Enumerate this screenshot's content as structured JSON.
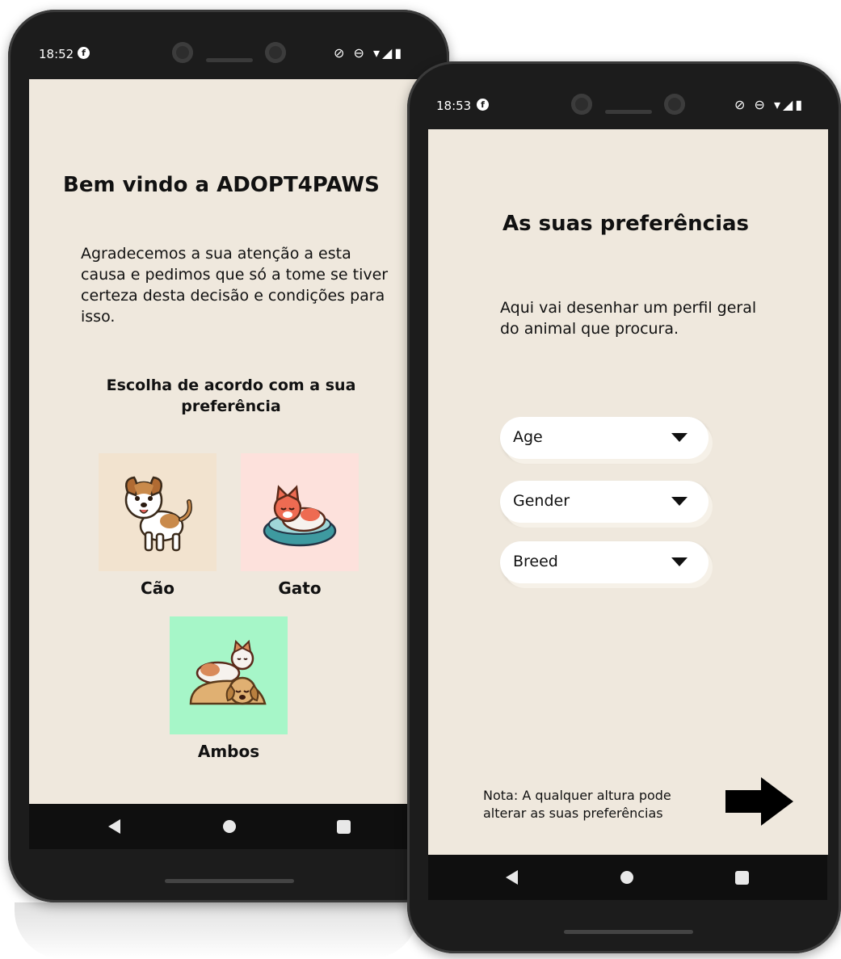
{
  "phone1": {
    "status": {
      "time": "18:52",
      "notify_glyph": "f",
      "sys_icons": "⊘ ⊖ ▾◢▮"
    },
    "title": "Bem vindo a ADOPT4PAWS",
    "intro": "Agradecemos a sua atenção a esta causa e pedimos que só a tome se tiver certeza desta decisão e condições para isso.",
    "choose_heading": "Escolha de acordo com a sua preferência",
    "options": [
      {
        "label": "Cão",
        "bg": "#f2e3cf",
        "icon": "dog-icon"
      },
      {
        "label": "Gato",
        "bg": "#fde1dc",
        "icon": "cat-icon"
      },
      {
        "label": "Ambos",
        "bg": "#a6f6c8",
        "icon": "dog-and-cat-icon"
      }
    ]
  },
  "phone2": {
    "status": {
      "time": "18:53",
      "notify_glyph": "f",
      "sys_icons": "⊘ ⊖ ▾◢▮"
    },
    "title": "As suas preferências",
    "intro": "Aqui vai desenhar um perfil geral do animal que procura.",
    "dropdowns": [
      {
        "label": "Age"
      },
      {
        "label": "Gender"
      },
      {
        "label": "Breed"
      }
    ],
    "note": "Nota: A qualquer altura pode alterar as suas preferências",
    "next_icon": "right-arrow-icon"
  },
  "colors": {
    "screen_bg": "#efe8dd",
    "frame": "#1c1c1c",
    "nav": "#0f0f0f"
  }
}
